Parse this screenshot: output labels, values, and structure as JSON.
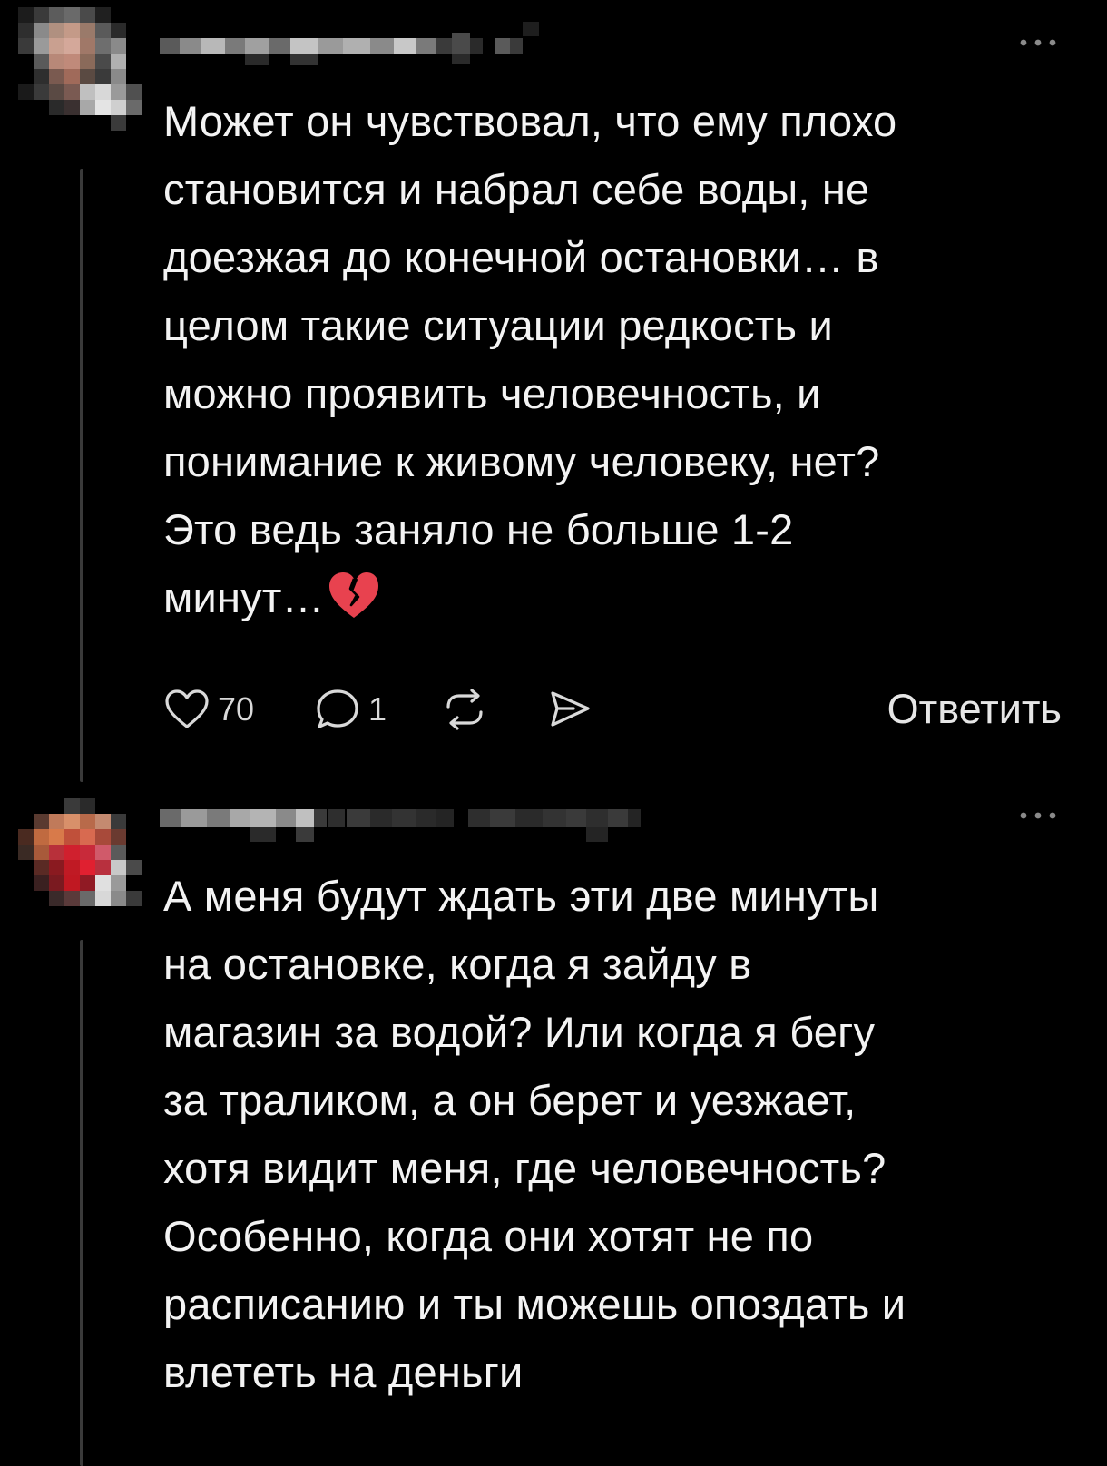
{
  "colors": {
    "background": "#000000",
    "text": "#f3f3f3",
    "thread_line": "#3a3a3a",
    "icon": "#d9d9d9",
    "broken_heart": "#e8424f"
  },
  "comments": [
    {
      "author_visible": false,
      "text": "Может он чувствовал, что ему плохо\nстановится и набрал себе воды, не\nдоезжая до конечной остановки… в\nцелом такие ситуации редкость и\nможно проявить человечность, и\nпонимание к живому человеку, нет?\nЭто ведь заняло не больше 1-2\nминут…",
      "emoji": "broken-heart",
      "actions": {
        "like_count": "70",
        "comment_count": "1",
        "reply_label": "Ответить"
      },
      "icons": [
        "heart-icon",
        "comment-icon",
        "repost-icon",
        "share-icon",
        "more-icon"
      ]
    },
    {
      "author_visible": false,
      "text": "А меня будут ждать эти две минуты\nна остановке, когда я зайду в\nмагазин за водой? Или когда я бегу\nза траликом, а он берет и уезжает,\nхотя видит меня, где человечность?\nОсобенно, когда они хотят не по\nрасписанию и ты можешь опоздать и\nвлететь на деньги",
      "icons": [
        "more-icon"
      ]
    }
  ]
}
